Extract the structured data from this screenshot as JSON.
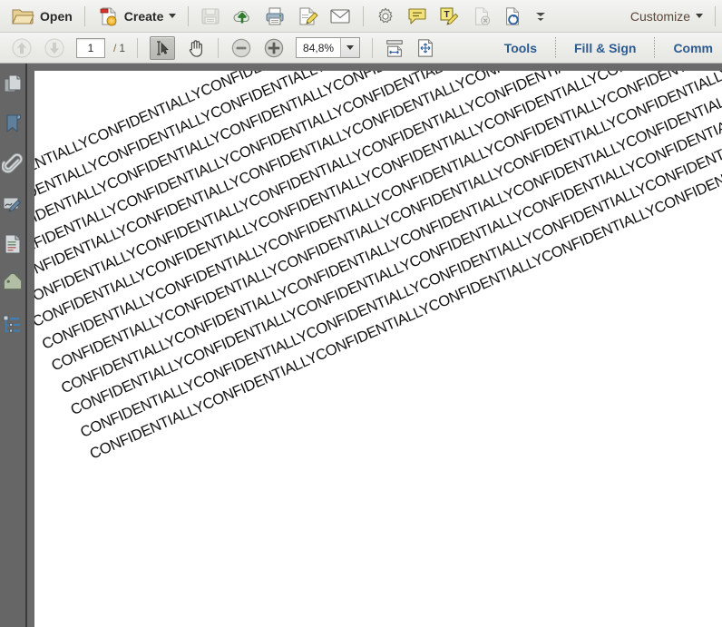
{
  "app": {
    "title": "PDF Reader"
  },
  "toolbar_main": {
    "open_label": "Open",
    "create_label": "Create",
    "customize_label": "Customize",
    "icons": [
      {
        "name": "folder-open-icon",
        "label": "Open"
      },
      {
        "name": "create-pdf-icon",
        "label": "Create"
      },
      {
        "name": "save-icon",
        "label": "Save"
      },
      {
        "name": "upload-cloud-icon",
        "label": "Send to cloud"
      },
      {
        "name": "print-icon",
        "label": "Print"
      },
      {
        "name": "sign-document-icon",
        "label": "Sign"
      },
      {
        "name": "email-icon",
        "label": "Email"
      },
      {
        "name": "settings-gear-icon",
        "label": "Settings"
      },
      {
        "name": "comment-bubble-icon",
        "label": "Add comment"
      },
      {
        "name": "highlight-text-icon",
        "label": "Highlight text"
      },
      {
        "name": "delete-page-icon",
        "label": "Delete page"
      },
      {
        "name": "rotate-page-icon",
        "label": "Rotate page"
      },
      {
        "name": "more-tools-icon",
        "label": "More tools"
      }
    ]
  },
  "toolbar_nav": {
    "page_current": "1",
    "page_separator": "/",
    "page_total": "1",
    "zoom_value": "84,8%",
    "tasks": [
      {
        "name": "tab-tools",
        "label": "Tools"
      },
      {
        "name": "tab-fill-and-sign",
        "label": "Fill & Sign"
      },
      {
        "name": "tab-comment",
        "label": "Comm"
      }
    ],
    "icons": [
      {
        "name": "previous-page-icon",
        "label": "Previous page"
      },
      {
        "name": "next-page-icon",
        "label": "Next page"
      },
      {
        "name": "select-tool-icon",
        "label": "Select tool"
      },
      {
        "name": "hand-tool-icon",
        "label": "Hand tool"
      },
      {
        "name": "zoom-out-icon",
        "label": "Zoom out"
      },
      {
        "name": "zoom-in-icon",
        "label": "Zoom in"
      },
      {
        "name": "fit-width-icon",
        "label": "Fit width"
      },
      {
        "name": "fit-page-icon",
        "label": "Fit page"
      }
    ]
  },
  "sidebar": {
    "items": [
      {
        "name": "sidebar-item-page-thumbnails",
        "label": "Page Thumbnails",
        "icon": "pages-icon"
      },
      {
        "name": "sidebar-item-bookmarks",
        "label": "Bookmarks",
        "icon": "bookmark-icon"
      },
      {
        "name": "sidebar-item-attachments",
        "label": "Attachments",
        "icon": "paperclip-icon"
      },
      {
        "name": "sidebar-item-signatures",
        "label": "Signatures",
        "icon": "signature-pen-icon"
      },
      {
        "name": "sidebar-item-content",
        "label": "Content",
        "icon": "content-document-icon"
      },
      {
        "name": "sidebar-item-tags",
        "label": "Tags",
        "icon": "tag-icon"
      },
      {
        "name": "sidebar-item-model-tree",
        "label": "Model Tree",
        "icon": "tree-structure-icon"
      }
    ]
  },
  "document": {
    "watermark_word": "CONFIDENTIALLY",
    "watermark_repeat_per_line": 9,
    "watermark_line_count": 13,
    "watermark_rotation_deg": -23.5,
    "watermark_color": "#111111",
    "page_background": "#ffffff"
  },
  "colors": {
    "toolbar_bg": "#ededea",
    "doc_backdrop": "#6a6a6a",
    "sidebar_bg": "#666666",
    "task_link": "#2b5b91",
    "customize_text": "#5c4638"
  }
}
